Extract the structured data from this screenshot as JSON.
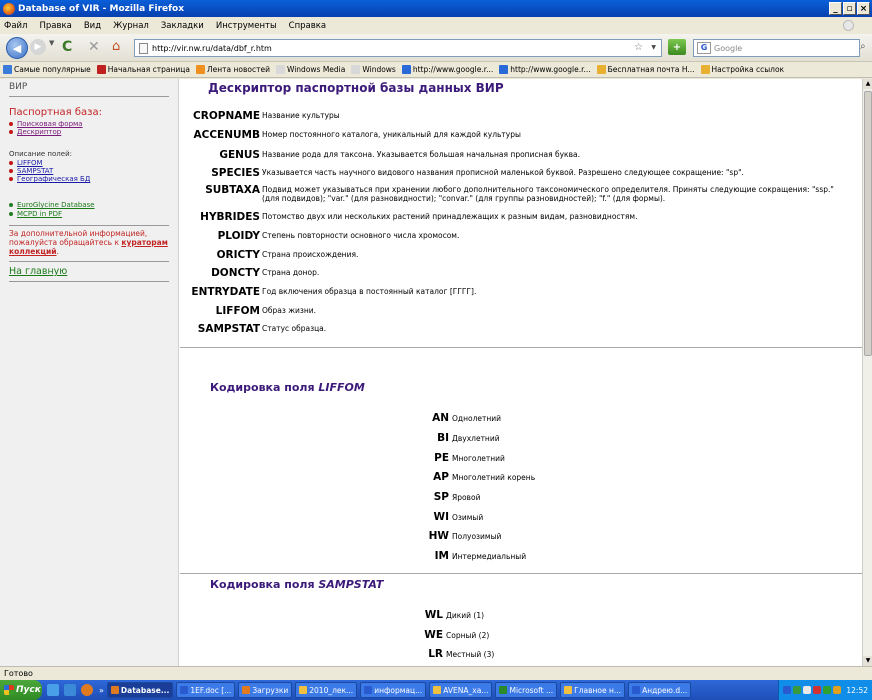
{
  "window": {
    "title": "Database of VIR - Mozilla Firefox"
  },
  "menu": [
    "Файл",
    "Правка",
    "Вид",
    "Журнал",
    "Закладки",
    "Инструменты",
    "Справка"
  ],
  "nav": {
    "url": "http://vir.nw.ru/data/dbf_r.htm",
    "search_placeholder": "Google"
  },
  "bookmarks": [
    {
      "label": "Самые популярные",
      "color": "#3a7ad8"
    },
    {
      "label": "Начальная страница",
      "color": "#c02020"
    },
    {
      "label": "Лента новостей",
      "color": "#f09020"
    },
    {
      "label": "Windows Media",
      "color": "#d8d8d8"
    },
    {
      "label": "Windows",
      "color": "#d8d8d8"
    },
    {
      "label": "http://www.google.r...",
      "color": "#2a6ad8"
    },
    {
      "label": "http://www.google.r...",
      "color": "#2a6ad8"
    },
    {
      "label": "Бесплатная почта H...",
      "color": "#e8b030"
    },
    {
      "label": "Настройка ссылок",
      "color": "#e8b030"
    }
  ],
  "sidebar": {
    "brand": "ВИР",
    "passport_title": "Паспортная база:",
    "search_form": "Поисковая форма",
    "descriptor": "Дескриптор",
    "fields_label": "Описание полей:",
    "field_links": [
      "LIFFOM",
      "SAMPSTAT",
      "Географическая БД"
    ],
    "external_links": [
      "EuroGlycine Database",
      "MCPD in PDF"
    ],
    "info_text": "За дополнительной информацией, пожалуйста обращайтесь к ",
    "info_link": "кураторам коллекций",
    "info_end": ".",
    "home": "На главную"
  },
  "main": {
    "title": "Дескриптор паспортной базы данных ВИР",
    "descriptors": [
      {
        "key": "CROPNAME",
        "desc": "Название культуры"
      },
      {
        "key": "ACCENUMB",
        "desc": "Номер постоянного каталога, уникальный для каждой культуры"
      },
      {
        "key": "GENUS",
        "desc": "Название рода для таксона. Указывается большая начальная прописная буква."
      },
      {
        "key": "SPECIES",
        "desc": "Указывается часть научного видового названия прописной маленькой буквой. Разрешено следующее сокращение: \"sp\"."
      },
      {
        "key": "SUBTAXA",
        "desc": "Подвид может указываться при хранении любого дополнительного таксономического определителя. Приняты следующие сокращения: \"ssp.\" (для подвидов); \"var.\" (для разновидности); \"convar.\" (для группы разновидностей); \"f.\" (для формы)."
      },
      {
        "key": "HYBRIDES",
        "desc": "Потомство двух или нескольких растений принадлежащих к разным видам, разновидностям."
      },
      {
        "key": "PLOIDY",
        "desc": "Степень повторности основного числа хромосом."
      },
      {
        "key": "ORICTY",
        "desc": "Страна происхождения."
      },
      {
        "key": "DONCTY",
        "desc": "Страна донор."
      },
      {
        "key": "ENTRYDATE",
        "desc": "Год включения образца в постоянный каталог [ГГГГ]."
      },
      {
        "key": "LIFFOM",
        "desc": "Образ жизни."
      },
      {
        "key": "SAMPSTAT",
        "desc": "Статус образца."
      }
    ],
    "liffom": {
      "title_prefix": "Кодировка поля ",
      "title_field": "LIFFOM",
      "codes": [
        {
          "code": "AN",
          "label": "Однолетний"
        },
        {
          "code": "BI",
          "label": "Двухлетний"
        },
        {
          "code": "PE",
          "label": "Многолетний"
        },
        {
          "code": "AP",
          "label": "Многолетний корень"
        },
        {
          "code": "SP",
          "label": "Яровой"
        },
        {
          "code": "WI",
          "label": "Озимый"
        },
        {
          "code": "HW",
          "label": "Полуозимый"
        },
        {
          "code": "IM",
          "label": "Интермедиальный"
        }
      ]
    },
    "sampstat": {
      "title_prefix": "Кодировка поля ",
      "title_field": "SAMPSTAT",
      "codes": [
        {
          "code": "WL",
          "label": "Дикий (1)"
        },
        {
          "code": "WE",
          "label": "Сорный (2)"
        },
        {
          "code": "LR",
          "label": "Местный (3)"
        }
      ]
    }
  },
  "status": "Готово",
  "taskbar": {
    "start": "Пуск",
    "tasks": [
      {
        "label": "Database...",
        "color": "#e07a20",
        "active": true
      },
      {
        "label": "1EF.doc [...",
        "color": "#2a5ad0",
        "active": false
      },
      {
        "label": "Загрузки",
        "color": "#e07a20",
        "active": false
      },
      {
        "label": "2010_лек...",
        "color": "#f0c040",
        "active": false
      },
      {
        "label": "информац...",
        "color": "#2a5ad0",
        "active": false
      },
      {
        "label": "AVENA_xa...",
        "color": "#f0c040",
        "active": false
      },
      {
        "label": "Microsoft ...",
        "color": "#2a8a2a",
        "active": false
      },
      {
        "label": "Главное н...",
        "color": "#f0c040",
        "active": false
      },
      {
        "label": "Андрею.d...",
        "color": "#2a5ad0",
        "active": false
      }
    ],
    "clock": "12:52"
  }
}
